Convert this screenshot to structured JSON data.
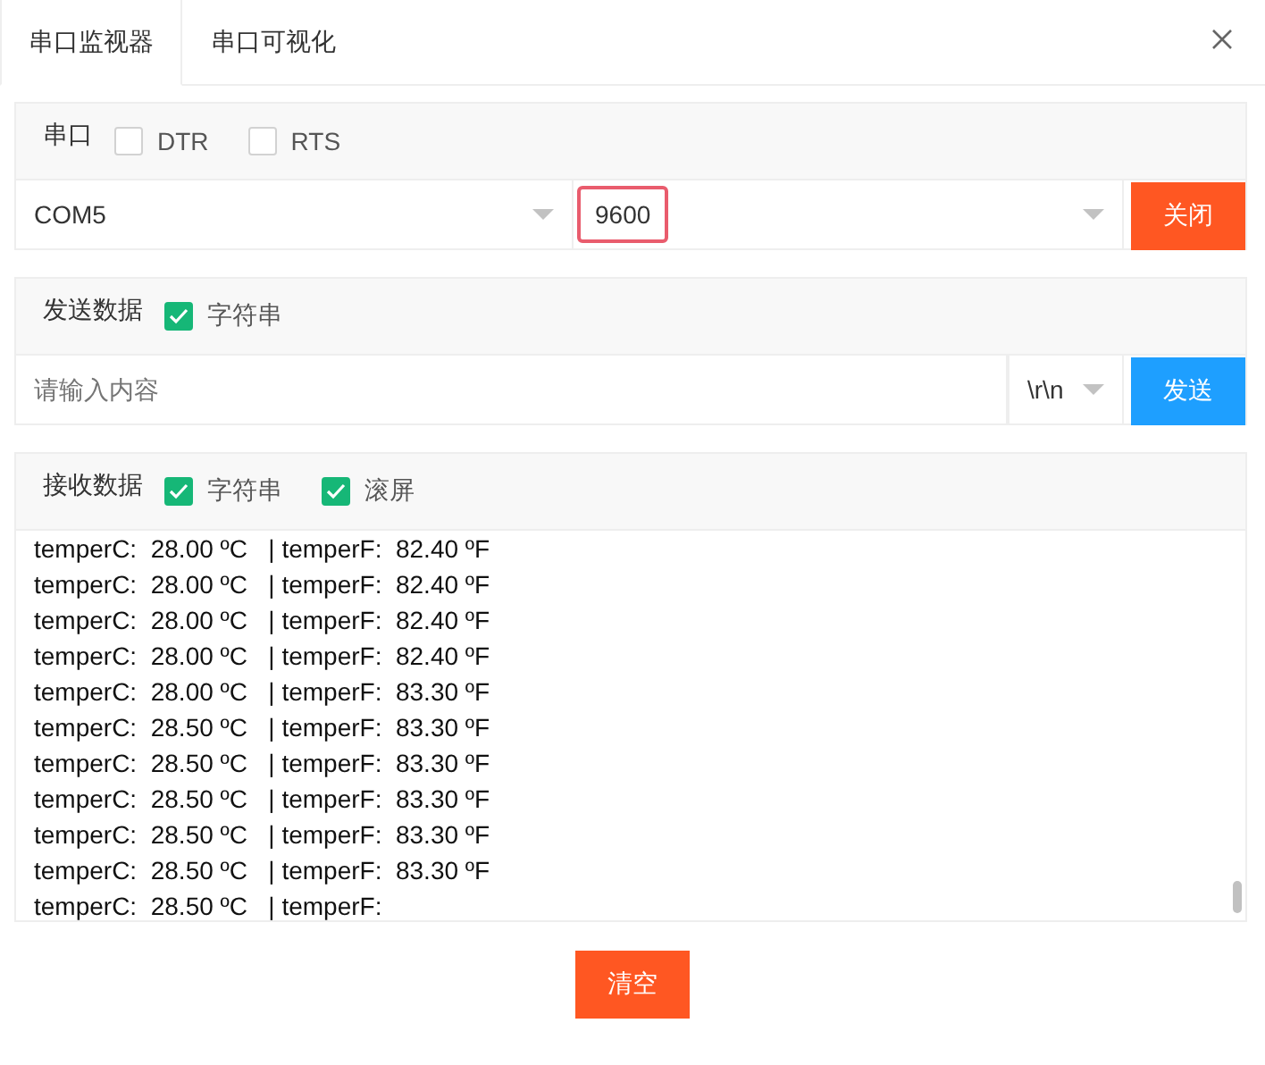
{
  "tabs": [
    {
      "label": "串口监视器",
      "selected": true
    },
    {
      "label": "串口可视化",
      "selected": false
    }
  ],
  "serial": {
    "label": "串口",
    "options": [
      {
        "label": "DTR",
        "checked": false
      },
      {
        "label": "RTS",
        "checked": false
      }
    ],
    "port": "COM5",
    "baud": {
      "value": "9600",
      "focused": true
    },
    "button": "关闭"
  },
  "send": {
    "label": "发送数据",
    "options": [
      {
        "label": "字符串",
        "checked": true
      }
    ],
    "placeholder": "请输入内容",
    "line_ending": "\\r\\n",
    "button": "发送"
  },
  "receive": {
    "label": "接收数据",
    "options": [
      {
        "label": "字符串",
        "checked": true
      },
      {
        "label": "滚屏",
        "checked": true
      }
    ],
    "lines": [
      "temperC:  28.00 ºC   | temperF:  82.40 ºF",
      "temperC:  28.00 ºC   | temperF:  82.40 ºF",
      "temperC:  28.00 ºC   | temperF:  82.40 ºF",
      "temperC:  28.00 ºC   | temperF:  82.40 ºF",
      "temperC:  28.00 ºC   | temperF:  83.30 ºF",
      "temperC:  28.50 ºC   | temperF:  83.30 ºF",
      "temperC:  28.50 ºC   | temperF:  83.30 ºF",
      "temperC:  28.50 ºC   | temperF:  83.30 ºF",
      "temperC:  28.50 ºC   | temperF:  83.30 ºF",
      "temperC:  28.50 ºC   | temperF:  83.30 ºF",
      "temperC:  28.50 ºC   | temperF:"
    ]
  },
  "clear_button": "清空"
}
